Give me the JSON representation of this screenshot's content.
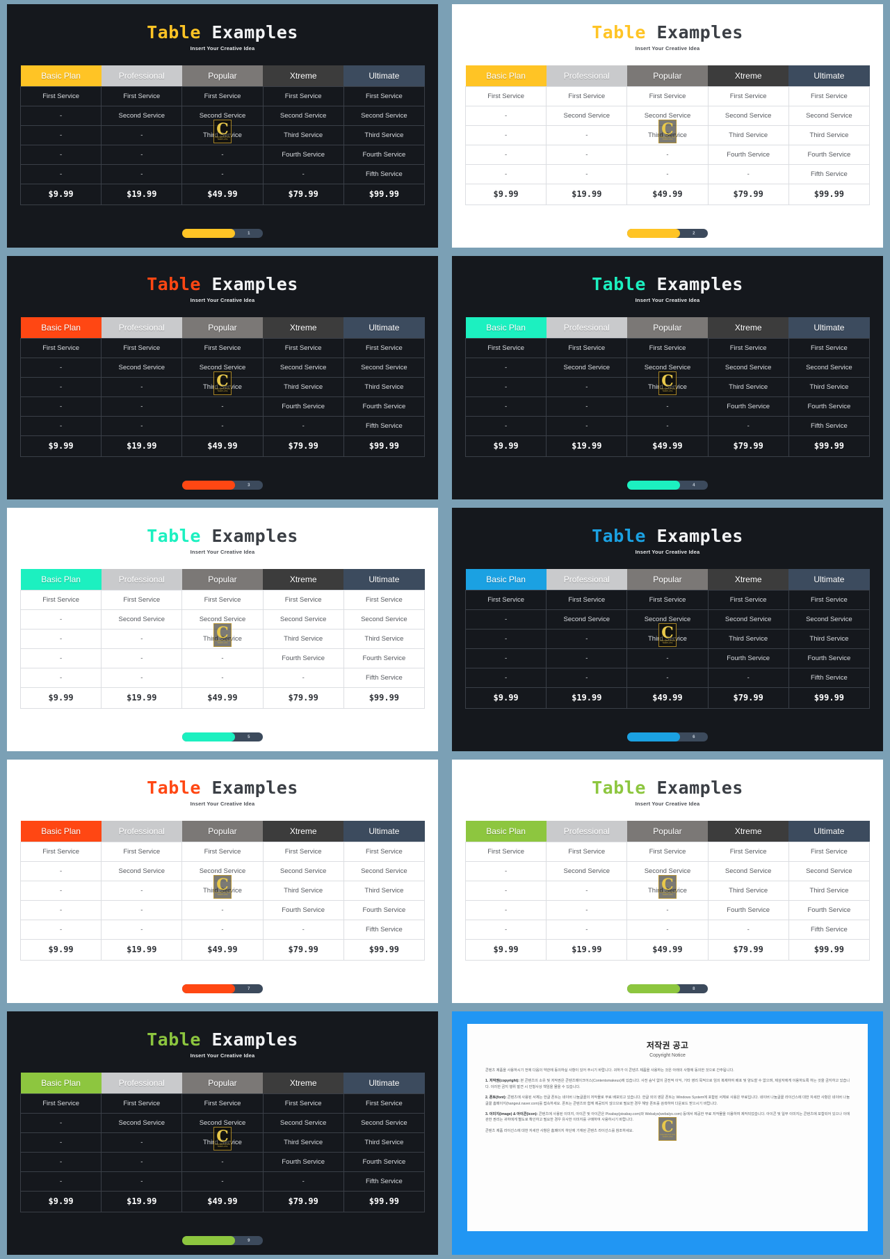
{
  "deck": {
    "title_accent": "Table",
    "title_rest": " Examples",
    "subtitle": "Insert Your Creative Idea",
    "watermark": {
      "letter": "C",
      "line1": "PRESENTATION",
      "line2": "TEMPLATE"
    }
  },
  "table": {
    "headers": [
      "Basic Plan",
      "Professional",
      "Popular",
      "Xtreme",
      "Ultimate"
    ],
    "header_colors": [
      "",
      "#c9cacc",
      "#7b7876",
      "#3c3c3c",
      "#3c4b5e"
    ],
    "rows": [
      [
        "First Service",
        "First Service",
        "First Service",
        "First Service",
        "First Service"
      ],
      [
        "-",
        "Second Service",
        "Second Service",
        "Second Service",
        "Second Service"
      ],
      [
        "-",
        "-",
        "Third Service",
        "Third Service",
        "Third Service"
      ],
      [
        "-",
        "-",
        "-",
        "Fourth Service",
        "Fourth Service"
      ],
      [
        "-",
        "-",
        "-",
        "-",
        "Fifth Service"
      ]
    ],
    "prices": [
      "$9.99",
      "$19.99",
      "$49.99",
      "$79.99",
      "$99.99"
    ]
  },
  "slides": [
    {
      "id": 1,
      "theme": "dark",
      "accent": "#ffc425",
      "page": "1"
    },
    {
      "id": 2,
      "theme": "light",
      "accent": "#ffc425",
      "page": "2"
    },
    {
      "id": 3,
      "theme": "dark",
      "accent": "#ff4713",
      "page": "3"
    },
    {
      "id": 4,
      "theme": "dark",
      "accent": "#1cf0c0",
      "page": "4"
    },
    {
      "id": 5,
      "theme": "light",
      "accent": "#1cf0c0",
      "page": "5"
    },
    {
      "id": 6,
      "theme": "dark",
      "accent": "#1ba1e2",
      "page": "6"
    },
    {
      "id": 7,
      "theme": "light",
      "accent": "#ff4713",
      "page": "7"
    },
    {
      "id": 8,
      "theme": "light",
      "accent": "#8dc63f",
      "page": "8"
    },
    {
      "id": 9,
      "theme": "dark",
      "accent": "#8dc63f",
      "page": "9"
    }
  ],
  "copyright": {
    "title": "저작권 공고",
    "subtitle": "Copyright Notice",
    "paragraphs": [
      "콘텐츠 제품을 사용하시기 전에 다음의 약관에 동의하실 사항이 있어 주시기 바랍니다. 귀하가 이 콘텐츠 제품을 사용하는 것은 아래의 사항에 동의한 것으로 간주됩니다.",
      "<b>1. 저작권(copyright):</b> 본 콘텐츠의 소유 및 저작권은 콘텐츠메이크어스(Contentsmakeus)에 있습니다. 사전 승낙 없이 금전적 이익, 기타 영리 목적으로 임의 복제하여 배포 및 양도할 수 없으며, 제삼자에게 이용하도록 하는 것을 금지하고 있습니다. 이러한 금지 행위 발견 시 민형사상 책임을 물을 수 있습니다.",
      "<b>2. 폰트(font):</b> 콘텐츠에 사용된 서체는 한글 폰트는 네이버 나눔글꼴의 저작물로 무료 배포되고 있습니다. 한글 외의 영문 폰트는 Windows System에 포함된 서체로 사용은 무료입니다. 네이버 나눔글꼴 라이선스에 대한 자세한 사항은 네이버 나눔글꼴 홈페이지(hangeul.naver.com)를 접속하세요. 폰트는 콘텐츠와 함께 제공되지 않으므로 필요한 경우 해당 폰트를 검색하여 다운로드 받으시기 바랍니다.",
      "<b>3. 이미지(image) &amp; 아이콘(icon):</b> 콘텐츠에 사용된 이미지, 아이콘 및 아이콘은 Pixabay(pixabay.com)와 Webalys(webalys.com) 등에서 제공한 무료 저작물을 이용하여 제작되었습니다. 아이콘 및 일부 이미지는 콘텐츠에 포함되어 있으나 이에 관한 권리는 귀하에게 별도로 확인하고 필요한 경우 유사한 이미지를 구매하여 사용하시기 바랍니다.",
      "콘텐츠 제품 라이선스에 대한 자세한 사항은 홈페이지 하단에 기재된 콘텐츠 라이선스를 참조하세요."
    ]
  }
}
